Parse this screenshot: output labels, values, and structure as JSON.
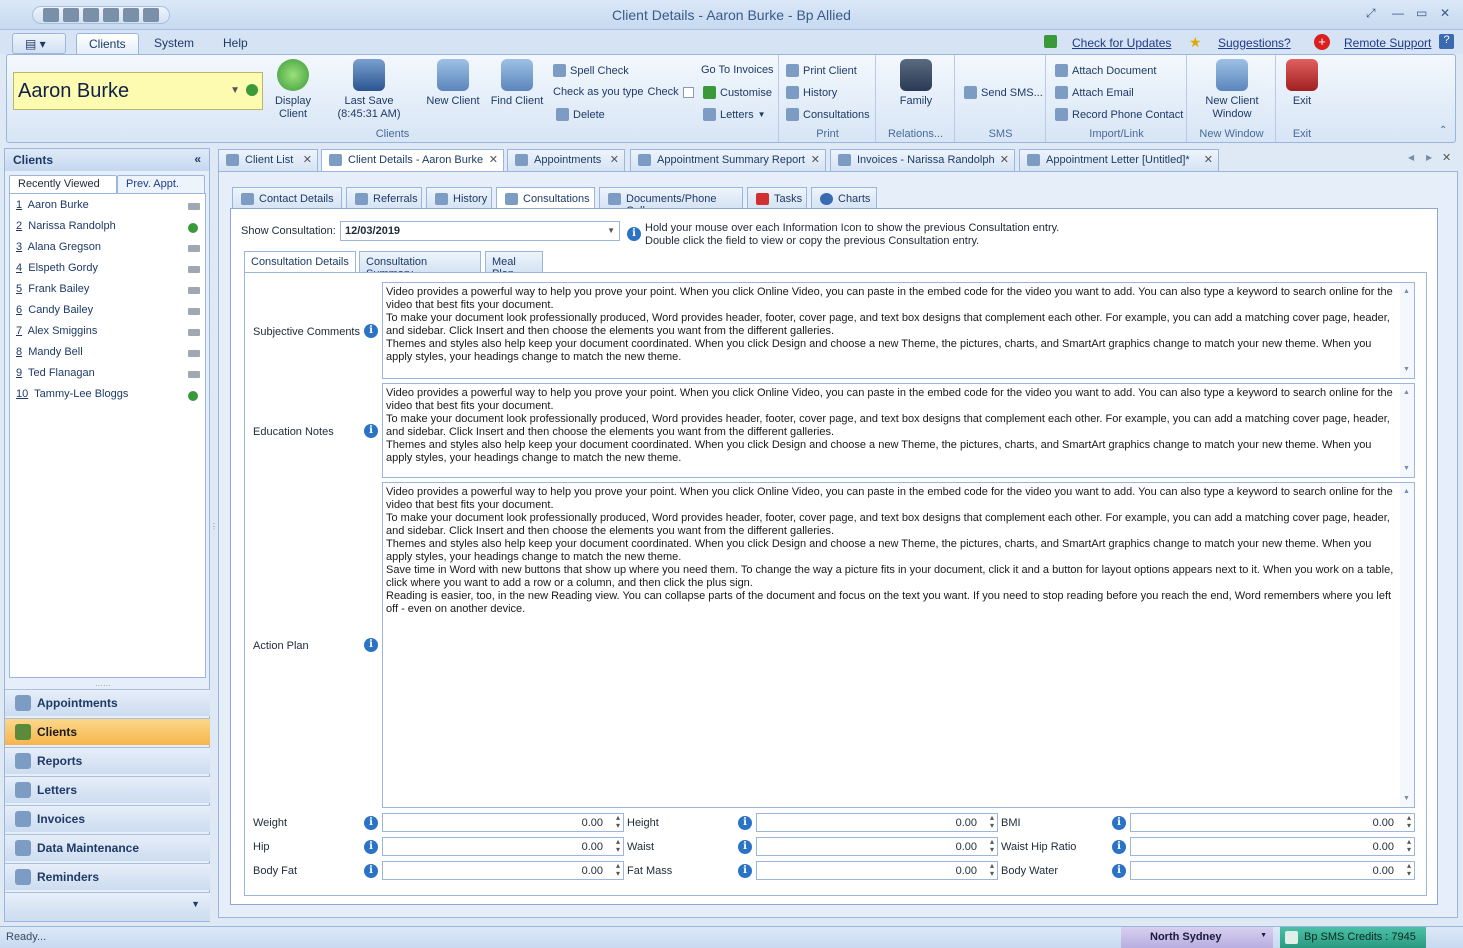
{
  "window": {
    "title": "Client Details - Aaron Burke - Bp Allied"
  },
  "menu": {
    "tabs": [
      "Clients",
      "System",
      "Help"
    ],
    "links": {
      "check_updates": "Check for Updates",
      "suggestions": "Suggestions?",
      "remote_support": "Remote Support"
    }
  },
  "ribbon": {
    "client_name": "Aaron Burke",
    "display_client": "Display Client",
    "last_save": "Last Save",
    "last_save_time": "(8:45:31 AM)",
    "new_client": "New Client",
    "find_client": "Find Client",
    "spell_check": "Spell Check",
    "check_as_you_type": "Check as you type",
    "check_label": "Check",
    "delete": "Delete",
    "go_to_invoices": "Go To Invoices",
    "customise": "Customise",
    "letters": "Letters",
    "clients_group": "Clients",
    "print_client": "Print Client",
    "history": "History",
    "consultations": "Consultations",
    "print_group": "Print",
    "family": "Family",
    "relations_group": "Relations...",
    "send_sms": "Send SMS...",
    "sms_group": "SMS",
    "attach_document": "Attach Document",
    "attach_email": "Attach Email",
    "record_phone_contact": "Record Phone Contact",
    "import_link_group": "Import/Link",
    "new_client_window": "New Client Window",
    "new_window_group": "New Window",
    "exit": "Exit",
    "exit_group": "Exit"
  },
  "left_panel": {
    "title": "Clients",
    "tabs": [
      "Recently Viewed",
      "Prev. Appt."
    ],
    "recent": [
      {
        "num": "1",
        "name": "Aaron Burke"
      },
      {
        "num": "2",
        "name": "Narissa Randolph"
      },
      {
        "num": "3",
        "name": "Alana Gregson"
      },
      {
        "num": "4",
        "name": "Elspeth Gordy"
      },
      {
        "num": "5",
        "name": "Frank Bailey"
      },
      {
        "num": "6",
        "name": "Candy Bailey"
      },
      {
        "num": "7",
        "name": "Alex Smiggins"
      },
      {
        "num": "8",
        "name": "Mandy Bell"
      },
      {
        "num": "9",
        "name": "Ted Flanagan"
      },
      {
        "num": "10",
        "name": "Tammy-Lee Bloggs"
      }
    ],
    "nav": [
      "Appointments",
      "Clients",
      "Reports",
      "Letters",
      "Invoices",
      "Data Maintenance",
      "Reminders"
    ]
  },
  "doc_tabs": [
    "Client List",
    "Client Details - Aaron Burke",
    "Appointments",
    "Appointment Summary Report",
    "Invoices - Narissa Randolph",
    "Appointment Letter [Untitled]*"
  ],
  "sub_tabs": [
    "Contact Details",
    "Referrals",
    "History",
    "Consultations",
    "Documents/Phone Calls",
    "Tasks",
    "Charts"
  ],
  "consultation": {
    "show_label": "Show Consultation:",
    "date": "12/03/2019",
    "hint1": "Hold your mouse over each Information Icon to show the previous Consultation entry.",
    "hint2": "Double click the field to view or copy the previous Consultation entry.",
    "tabs": [
      "Consultation Details",
      "Consultation Summary",
      "Meal Plan"
    ],
    "subjective_label": "Subjective Comments",
    "education_label": "Education Notes",
    "action_label": "Action Plan",
    "para1": "Video provides a powerful way to help you prove your point. When you click Online Video, you can paste in the embed code for the video you want to add. You can also type a keyword to search online for the video that best fits your document.",
    "para2": "To make your document look professionally produced, Word provides header, footer, cover page, and text box designs that complement each other. For example, you can add a matching cover page, header, and sidebar. Click Insert and then choose the elements you want from the different galleries.",
    "para3": "Themes and styles also help keep your document coordinated. When you click Design and choose a new Theme, the pictures, charts, and SmartArt graphics change to match your new theme. When you apply styles, your headings change to match the new theme.",
    "para4": "Save time in Word with new buttons that show up where you need them. To change the way a picture fits in your document, click it and a button for layout options appears next to it. When you work on a table, click where you want to add a row or a column, and then click the plus sign.",
    "para5": "Reading is easier, too, in the new Reading view. You can collapse parts of the document and focus on the text you want. If you need to stop reading before you reach the end, Word remembers where you left off - even on another device.",
    "measures": [
      {
        "label": "Weight",
        "value": "0.00"
      },
      {
        "label": "Height",
        "value": "0.00"
      },
      {
        "label": "BMI",
        "value": "0.00"
      },
      {
        "label": "Hip",
        "value": "0.00"
      },
      {
        "label": "Waist",
        "value": "0.00"
      },
      {
        "label": "Waist Hip Ratio",
        "value": "0.00"
      },
      {
        "label": "Body Fat",
        "value": "0.00"
      },
      {
        "label": "Fat Mass",
        "value": "0.00"
      },
      {
        "label": "Body Water",
        "value": "0.00"
      }
    ]
  },
  "status": {
    "ready": "Ready...",
    "location": "North Sydney",
    "sms_credits": "Bp SMS Credits : 7945"
  }
}
